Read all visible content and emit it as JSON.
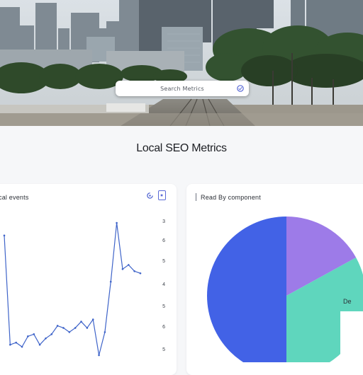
{
  "hero": {
    "search": {
      "placeholder": "Search Metrics"
    },
    "search_icon": "search-icon"
  },
  "page_title": "Local SEO Metrics",
  "cards": {
    "left": {
      "title": "cal events",
      "refresh_icon": "refresh-icon",
      "export_icon": "export-icon",
      "axis_ticks": [
        "3",
        "6",
        "5",
        "4",
        "5",
        "6",
        "5"
      ]
    },
    "right": {
      "title": "Read By component",
      "legend_label": "De"
    }
  },
  "colors": {
    "accent": "#3957d9",
    "line": "#3f64c9",
    "pie_blue": "#4262e6",
    "pie_purple": "#9d7be8",
    "pie_teal": "#5fd6bd"
  },
  "chart_data": [
    {
      "type": "line",
      "title": "cal events",
      "y_tick_labels": [
        "3",
        "6",
        "5",
        "4",
        "5",
        "6",
        "5"
      ],
      "series": [
        {
          "values": [
            2.9,
            0.3,
            0.35,
            0.25,
            0.5,
            0.55,
            0.3,
            0.45,
            0.55,
            0.75,
            0.7,
            0.6,
            0.7,
            0.85,
            0.7,
            0.9,
            0.05,
            0.6,
            1.8,
            3.2,
            2.1,
            2.2,
            2.05,
            2.0
          ]
        }
      ]
    },
    {
      "type": "pie",
      "title": "Read By component",
      "slices": [
        {
          "value": 50
        },
        {
          "value": 17
        },
        {
          "value": 33
        }
      ],
      "legend": [
        "De"
      ]
    }
  ]
}
